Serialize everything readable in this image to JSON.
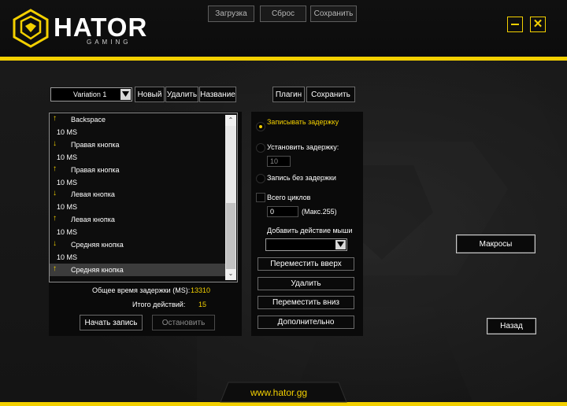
{
  "app": {
    "brand": "HATOR",
    "brand_sub": "GAMING",
    "website": "www.hator.gg"
  },
  "top_buttons": [
    "Загрузка",
    "Сброс",
    "Сохранить"
  ],
  "window_controls": {
    "minimize_icon": "minus-icon",
    "close_icon": "x-icon"
  },
  "macro_bar": {
    "selected_macro": "Variation 1",
    "new_label": "Новый",
    "delete_label": "Удалить",
    "rename_label": "Название"
  },
  "plugin_bar": {
    "plugin_label": "Плагин",
    "save_label": "Сохранить"
  },
  "actions_list": [
    {
      "icon": "arrow-up-icon",
      "text": "Backspace",
      "selected": false
    },
    {
      "icon": "",
      "text": "10 MS",
      "selected": false
    },
    {
      "icon": "arrow-down-icon",
      "text": "Правая кнопка",
      "selected": false
    },
    {
      "icon": "",
      "text": "10 MS",
      "selected": false
    },
    {
      "icon": "arrow-up-icon",
      "text": "Правая кнопка",
      "selected": false
    },
    {
      "icon": "",
      "text": "10 MS",
      "selected": false
    },
    {
      "icon": "arrow-down-icon",
      "text": "Левая кнопка",
      "selected": false
    },
    {
      "icon": "",
      "text": "10 MS",
      "selected": false
    },
    {
      "icon": "arrow-up-icon",
      "text": "Левая кнопка",
      "selected": false
    },
    {
      "icon": "",
      "text": "10 MS",
      "selected": false
    },
    {
      "icon": "arrow-down-icon",
      "text": "Средняя кнопка",
      "selected": false
    },
    {
      "icon": "",
      "text": "10 MS",
      "selected": false
    },
    {
      "icon": "arrow-up-icon",
      "text": "Средняя кнопка",
      "selected": true
    }
  ],
  "totals": {
    "delay_label": "Общее время задержки (MS):",
    "delay_value": "13310",
    "actions_label": "Итого действий:",
    "actions_value": "15"
  },
  "record_buttons": {
    "start_label": "Начать запись",
    "stop_label": "Остановить"
  },
  "options": {
    "record_delay_label": "Записывать задержку",
    "set_delay_label": "Установить задержку:",
    "set_delay_value": "10",
    "no_delay_label": "Запись без задержки",
    "selected_option": "record_delay",
    "cycles_label": "Всего циклов",
    "cycles_value": "0",
    "cycles_max": "(Макс.255)",
    "mouse_action_label": "Добавить действие мыши",
    "mouse_action_value": ""
  },
  "list_actions": {
    "move_up_label": "Переместить вверх",
    "delete_label": "Удалить",
    "move_down_label": "Переместить вниз",
    "more_label": "Дополнительно"
  },
  "nav": {
    "macros_label": "Макросы",
    "back_label": "Назад"
  },
  "colors": {
    "accent": "#f3d000",
    "background": "#171717",
    "panel": "#0a0a0a"
  }
}
